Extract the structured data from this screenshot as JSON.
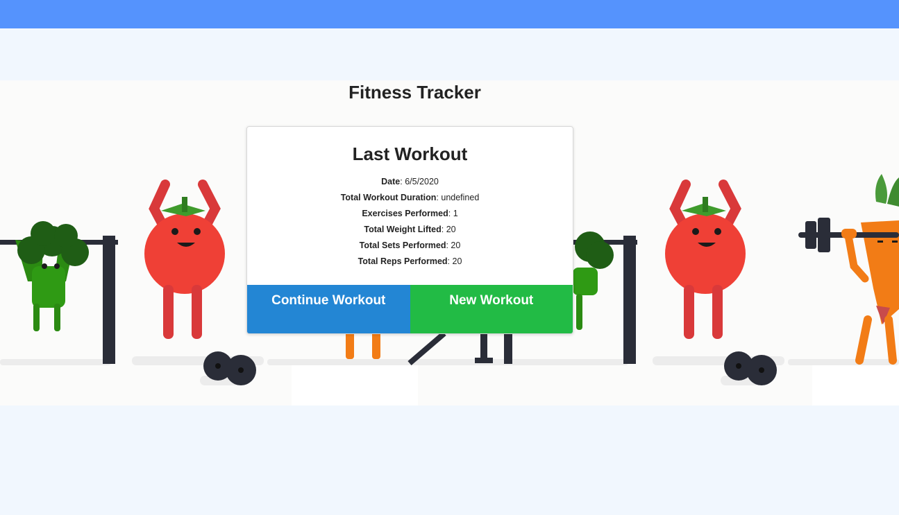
{
  "page": {
    "title": "Fitness Tracker"
  },
  "card": {
    "title": "Last Workout",
    "stats": [
      {
        "label": "Date",
        "value": "6/5/2020"
      },
      {
        "label": "Total Workout Duration",
        "value": "undefined"
      },
      {
        "label": "Exercises Performed",
        "value": "1"
      },
      {
        "label": "Total Weight Lifted",
        "value": "20"
      },
      {
        "label": "Total Sets Performed",
        "value": "20"
      },
      {
        "label": "Total Reps Performed",
        "value": "20"
      }
    ],
    "continue_label": "Continue Workout",
    "new_label": "New Workout"
  },
  "colors": {
    "topbar": "#5593fd",
    "background": "#f1f7fe",
    "continue_button": "#2386d4",
    "new_button": "#22bb45"
  }
}
